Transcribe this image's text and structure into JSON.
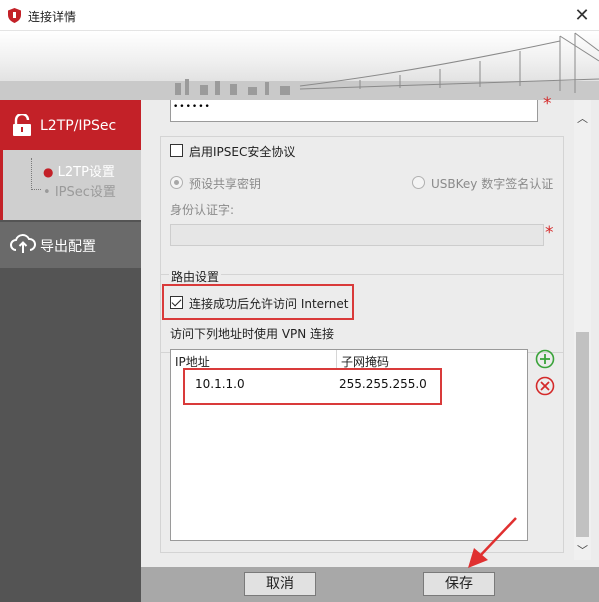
{
  "window": {
    "title": "连接详情",
    "close_glyph": "✕",
    "app_icon": "shield-icon"
  },
  "sidebar": {
    "items": [
      {
        "label": "L2TP/IPSec",
        "icon": "unlock-icon",
        "active": true
      },
      {
        "label": "导出配置",
        "icon": "cloud-upload-icon",
        "active": false
      }
    ],
    "sub_items": [
      {
        "label": "L2TP设置",
        "active": true
      },
      {
        "label": "IPSec设置",
        "active": false
      }
    ]
  },
  "form": {
    "password_mask": "••••••",
    "required_mark": "*",
    "enable_ipsec_label": "启用IPSEC安全协议",
    "enable_ipsec_checked": false,
    "auth_options": [
      {
        "label": "预设共享密钥",
        "selected": true
      },
      {
        "label": "USBKey 数字签名认证",
        "selected": false
      }
    ],
    "id_cert_label": "身份认证字:",
    "id_cert_value": ""
  },
  "routing": {
    "group_title": "路由设置",
    "allow_internet_label": "连接成功后允许访问 Internet",
    "allow_internet_checked": true,
    "vpn_routes_label": "访问下列地址时使用 VPN 连接",
    "table": {
      "columns": [
        "IP地址",
        "子网掩码"
      ],
      "rows": [
        {
          "ip": "10.1.1.0",
          "mask": "255.255.255.0"
        }
      ]
    },
    "add_icon": "plus-circle-icon",
    "delete_icon": "x-circle-icon"
  },
  "footer": {
    "cancel_label": "取消",
    "save_label": "保存"
  },
  "colors": {
    "accent_red": "#c32128",
    "sidebar_bg": "#545454",
    "content_bg": "#ececec",
    "highlight_box": "#d93a3a",
    "add_green": "#3aa33a"
  }
}
